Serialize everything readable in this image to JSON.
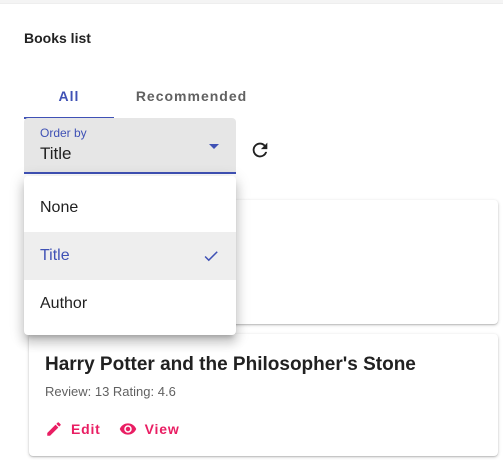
{
  "panel": {
    "title": "Books list"
  },
  "tabs": [
    {
      "label": "All",
      "active": true
    },
    {
      "label": "Recommended",
      "active": false
    }
  ],
  "order_select": {
    "label": "Order by",
    "value": "Title",
    "options": [
      {
        "label": "None",
        "selected": false
      },
      {
        "label": "Title",
        "selected": true
      },
      {
        "label": "Author",
        "selected": false
      }
    ]
  },
  "books": [
    {
      "title": "Harry Potter and the Philosopher's Stone",
      "meta": "Review: 13 Rating: 4.6",
      "actions": {
        "edit": "Edit",
        "view": "View"
      }
    }
  ],
  "icons": {
    "refresh": "refresh-icon",
    "edit": "pencil-icon",
    "view": "eye-icon",
    "check": "check-icon"
  },
  "colors": {
    "primary": "#3f51b5",
    "accent": "#e91e63",
    "selected_bg": "#eeeeee"
  }
}
